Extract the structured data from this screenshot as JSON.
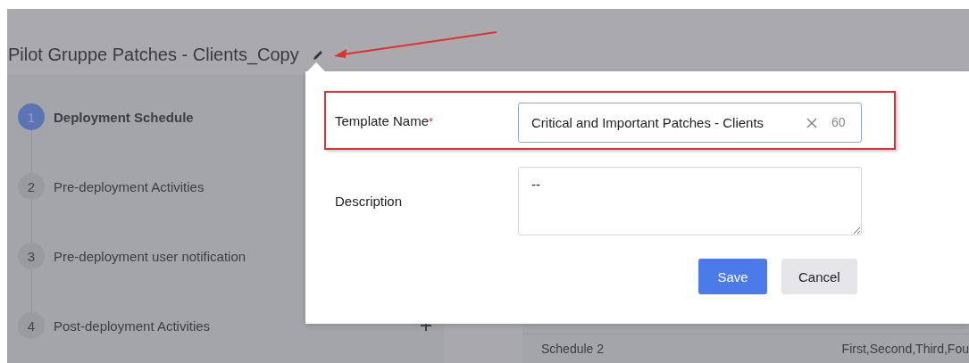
{
  "page": {
    "title": "Pilot Gruppe Patches - Clients_Copy"
  },
  "steps": [
    {
      "number": "1",
      "label": "Deployment Schedule",
      "selected": true
    },
    {
      "number": "2",
      "label": "Pre-deployment Activities",
      "selected": false
    },
    {
      "number": "3",
      "label": "Pre-deployment user notification",
      "selected": false
    },
    {
      "number": "4",
      "label": "Post-deployment Activities",
      "selected": false
    }
  ],
  "table": {
    "rows": [
      {
        "column_1": "Schedule 2",
        "column_2": "First,Second,Third,Fou"
      }
    ]
  },
  "popover": {
    "fields": [
      {
        "kind": "text",
        "label": "Template Name",
        "required_mark": "*",
        "value": "Critical and Important Patches - Clients",
        "counter": "60"
      },
      {
        "kind": "textarea",
        "label": "Description",
        "value": "--"
      }
    ],
    "buttons": [
      {
        "label": "Save",
        "primary": true
      },
      {
        "label": "Cancel",
        "primary": false
      }
    ]
  }
}
